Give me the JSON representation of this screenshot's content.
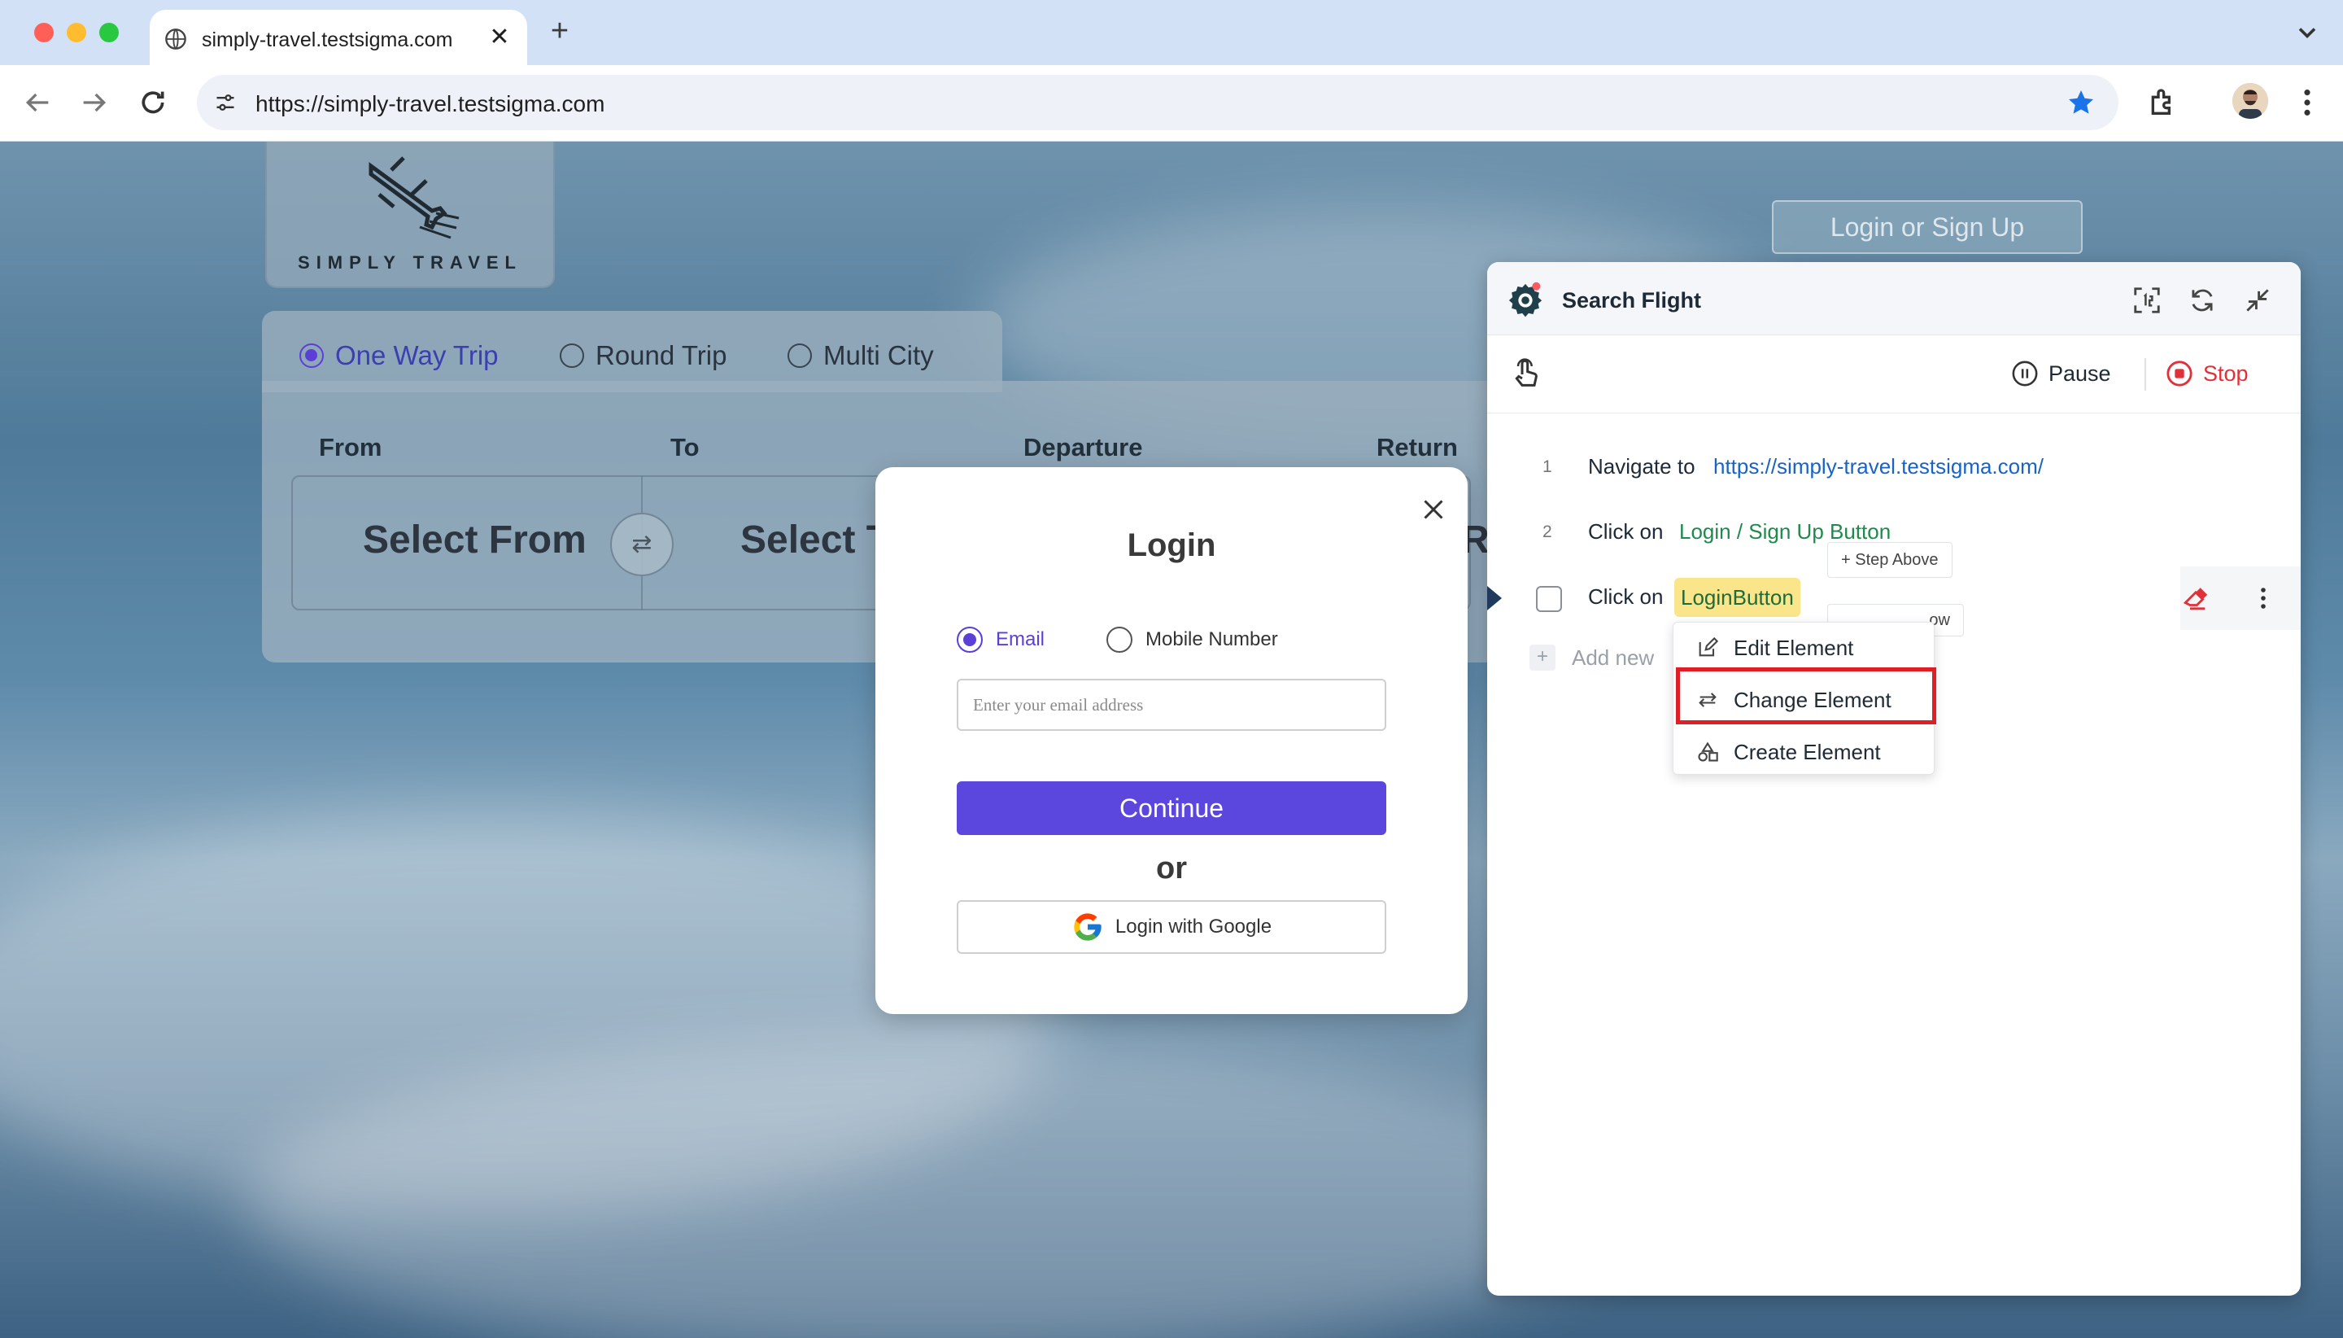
{
  "browser": {
    "tab_title": "simply-travel.testsigma.com",
    "url": "https://simply-travel.testsigma.com",
    "icons": [
      "globe-icon",
      "close-icon",
      "plus-icon",
      "back-icon",
      "forward-icon",
      "reload-icon",
      "site-settings-icon",
      "star-icon",
      "extensions-icon",
      "avatar",
      "kebab-icon"
    ]
  },
  "site": {
    "logo_text": "SIMPLY TRAVEL",
    "login_signup": "Login or Sign Up",
    "trip_types": [
      "One Way Trip",
      "Round Trip",
      "Multi City"
    ],
    "selected_trip": "One Way Trip",
    "fields": {
      "from": "From",
      "to": "To",
      "departure": "Departure",
      "return": "Return"
    },
    "select_from": "Select From",
    "select_to": "Select T",
    "partial_return": "R"
  },
  "login_modal": {
    "title": "Login",
    "options": [
      "Email",
      "Mobile Number"
    ],
    "selected": "Email",
    "email_placeholder": "Enter your email address",
    "continue_label": "Continue",
    "or_text": "or",
    "google_label": "Login with Google"
  },
  "recorder": {
    "title": "Search Flight",
    "pause_label": "Pause",
    "stop_label": "Stop",
    "steps": [
      {
        "num": "1",
        "action": "Navigate to",
        "target": "https://simply-travel.testsigma.com/"
      },
      {
        "num": "2",
        "action": "Click on",
        "target": "Login / Sign Up Button"
      },
      {
        "num": "",
        "action": "Click on",
        "target": "LoginButton"
      }
    ],
    "step_above": "Step Above",
    "step_below_partial": "ow",
    "add_new": "Add new",
    "context_menu": [
      "Edit Element",
      "Change Element",
      "Create Element"
    ],
    "highlighted_item": "Change Element"
  },
  "colors": {
    "accent": "#5b47de",
    "stop": "#e0303a",
    "highlight": "#e01e26",
    "chip": "#fbe58a",
    "link": "#1763c6"
  }
}
